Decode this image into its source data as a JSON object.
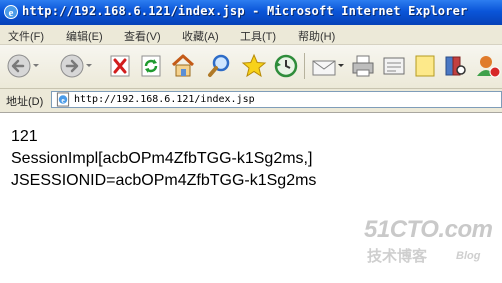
{
  "window": {
    "title": "http://192.168.6.121/index.jsp - Microsoft Internet Explorer"
  },
  "menu": {
    "items": [
      {
        "label": "文件(F)"
      },
      {
        "label": "编辑(E)"
      },
      {
        "label": "查看(V)"
      },
      {
        "label": "收藏(A)"
      },
      {
        "label": "工具(T)"
      },
      {
        "label": "帮助(H)"
      }
    ]
  },
  "toolbar": {
    "buttons": [
      "back-icon",
      "forward-icon",
      "stop-icon",
      "refresh-icon",
      "home-icon",
      "search-icon",
      "favorites-icon",
      "history-icon",
      "mail-icon",
      "print-icon",
      "edit-icon",
      "discuss-icon",
      "research-icon",
      "messenger-icon"
    ]
  },
  "address": {
    "label": "地址(D)",
    "url": "http://192.168.6.121/index.jsp"
  },
  "content": {
    "lines": [
      "121",
      "SessionImpl[acbOPm4ZfbTGG-k1Sg2ms,]",
      "JSESSIONID=acbOPm4ZfbTGG-k1Sg2ms"
    ]
  },
  "watermark": {
    "logo": "51CTO.com",
    "subtitle": "技术博客",
    "blog": "Blog"
  },
  "colors": {
    "titlebar": "#0a55d8",
    "chrome": "#ece9d8"
  }
}
